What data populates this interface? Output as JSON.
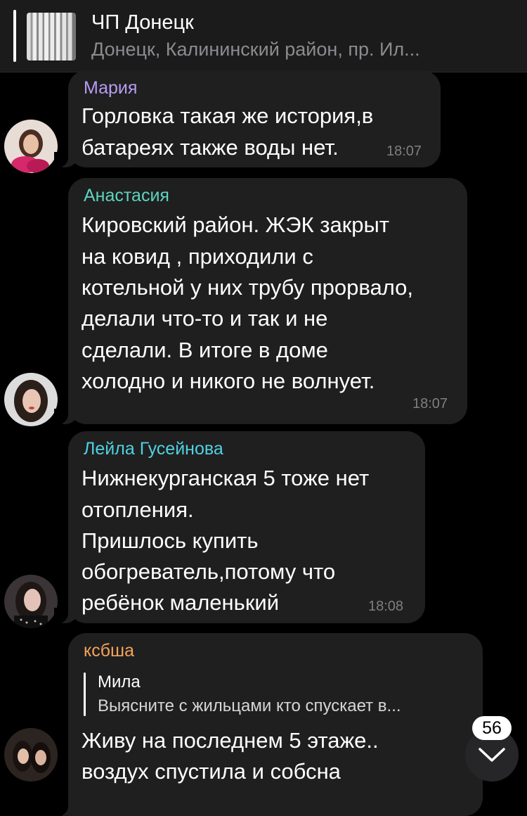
{
  "pinned": {
    "title": "ЧП Донецк",
    "subtitle": "Донецк, Калининский район, пр. Ил..."
  },
  "messages": [
    {
      "sender": "Мария",
      "sender_color": "#b79cf5",
      "lines": [
        "Горловка такая же история,в",
        "батареях также воды нет."
      ],
      "time": "18:07"
    },
    {
      "sender": "Анастасия",
      "sender_color": "#5fd3c1",
      "lines": [
        "Кировский район. ЖЭК закрыт",
        "на ковид , приходили с",
        "котельной у них трубу прорвало,",
        "делали что-то и так и не",
        "сделали. В итоге в доме",
        "холодно и никого не волнует."
      ],
      "time": "18:07"
    },
    {
      "sender": "Лейла Гусейнова",
      "sender_color": "#4fd2e0",
      "lines": [
        "Нижнекурганская 5 тоже нет",
        "отопления.",
        "Пришлось купить",
        "обогреватель,потому что",
        "ребёнок маленький"
      ],
      "time": "18:08"
    },
    {
      "sender": "ксбша",
      "sender_color": "#f4a35a",
      "reply": {
        "name": "Мила",
        "text": "Выясните с жильцами кто спускает в..."
      },
      "lines": [
        "Живу на последнем 5 этаже..",
        "воздух спустила и собсна"
      ]
    }
  ],
  "scroll_down": {
    "unread_count": "56",
    "icon": "chevron-down-icon"
  }
}
